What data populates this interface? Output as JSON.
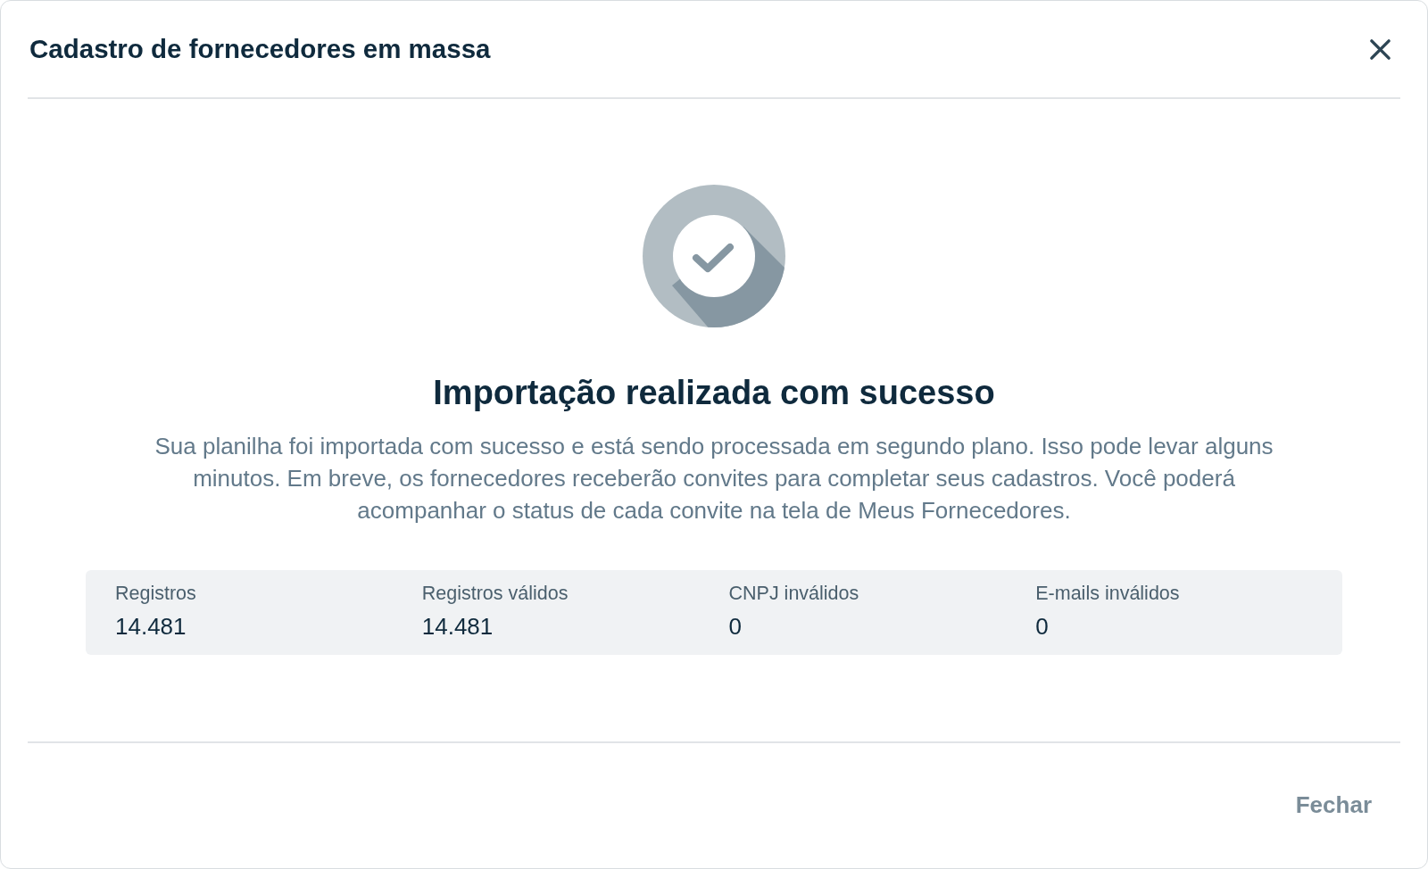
{
  "dialog": {
    "title": "Cadastro de fornecedores em massa"
  },
  "message": {
    "heading": "Importação realizada com sucesso",
    "body": "Sua planilha foi importada com sucesso e está sendo processada em segundo plano. Isso pode levar alguns minutos. Em breve, os fornecedores receberão convites para completar seus cadastros. Você poderá acompanhar o status de cada convite na tela de Meus Fornecedores."
  },
  "stats": [
    {
      "label": "Registros",
      "value": "14.481"
    },
    {
      "label": "Registros válidos",
      "value": "14.481"
    },
    {
      "label": "CNPJ inválidos",
      "value": "0"
    },
    {
      "label": "E-mails inválidos",
      "value": "0"
    }
  ],
  "footer": {
    "buttons": [
      "Fechar"
    ]
  }
}
